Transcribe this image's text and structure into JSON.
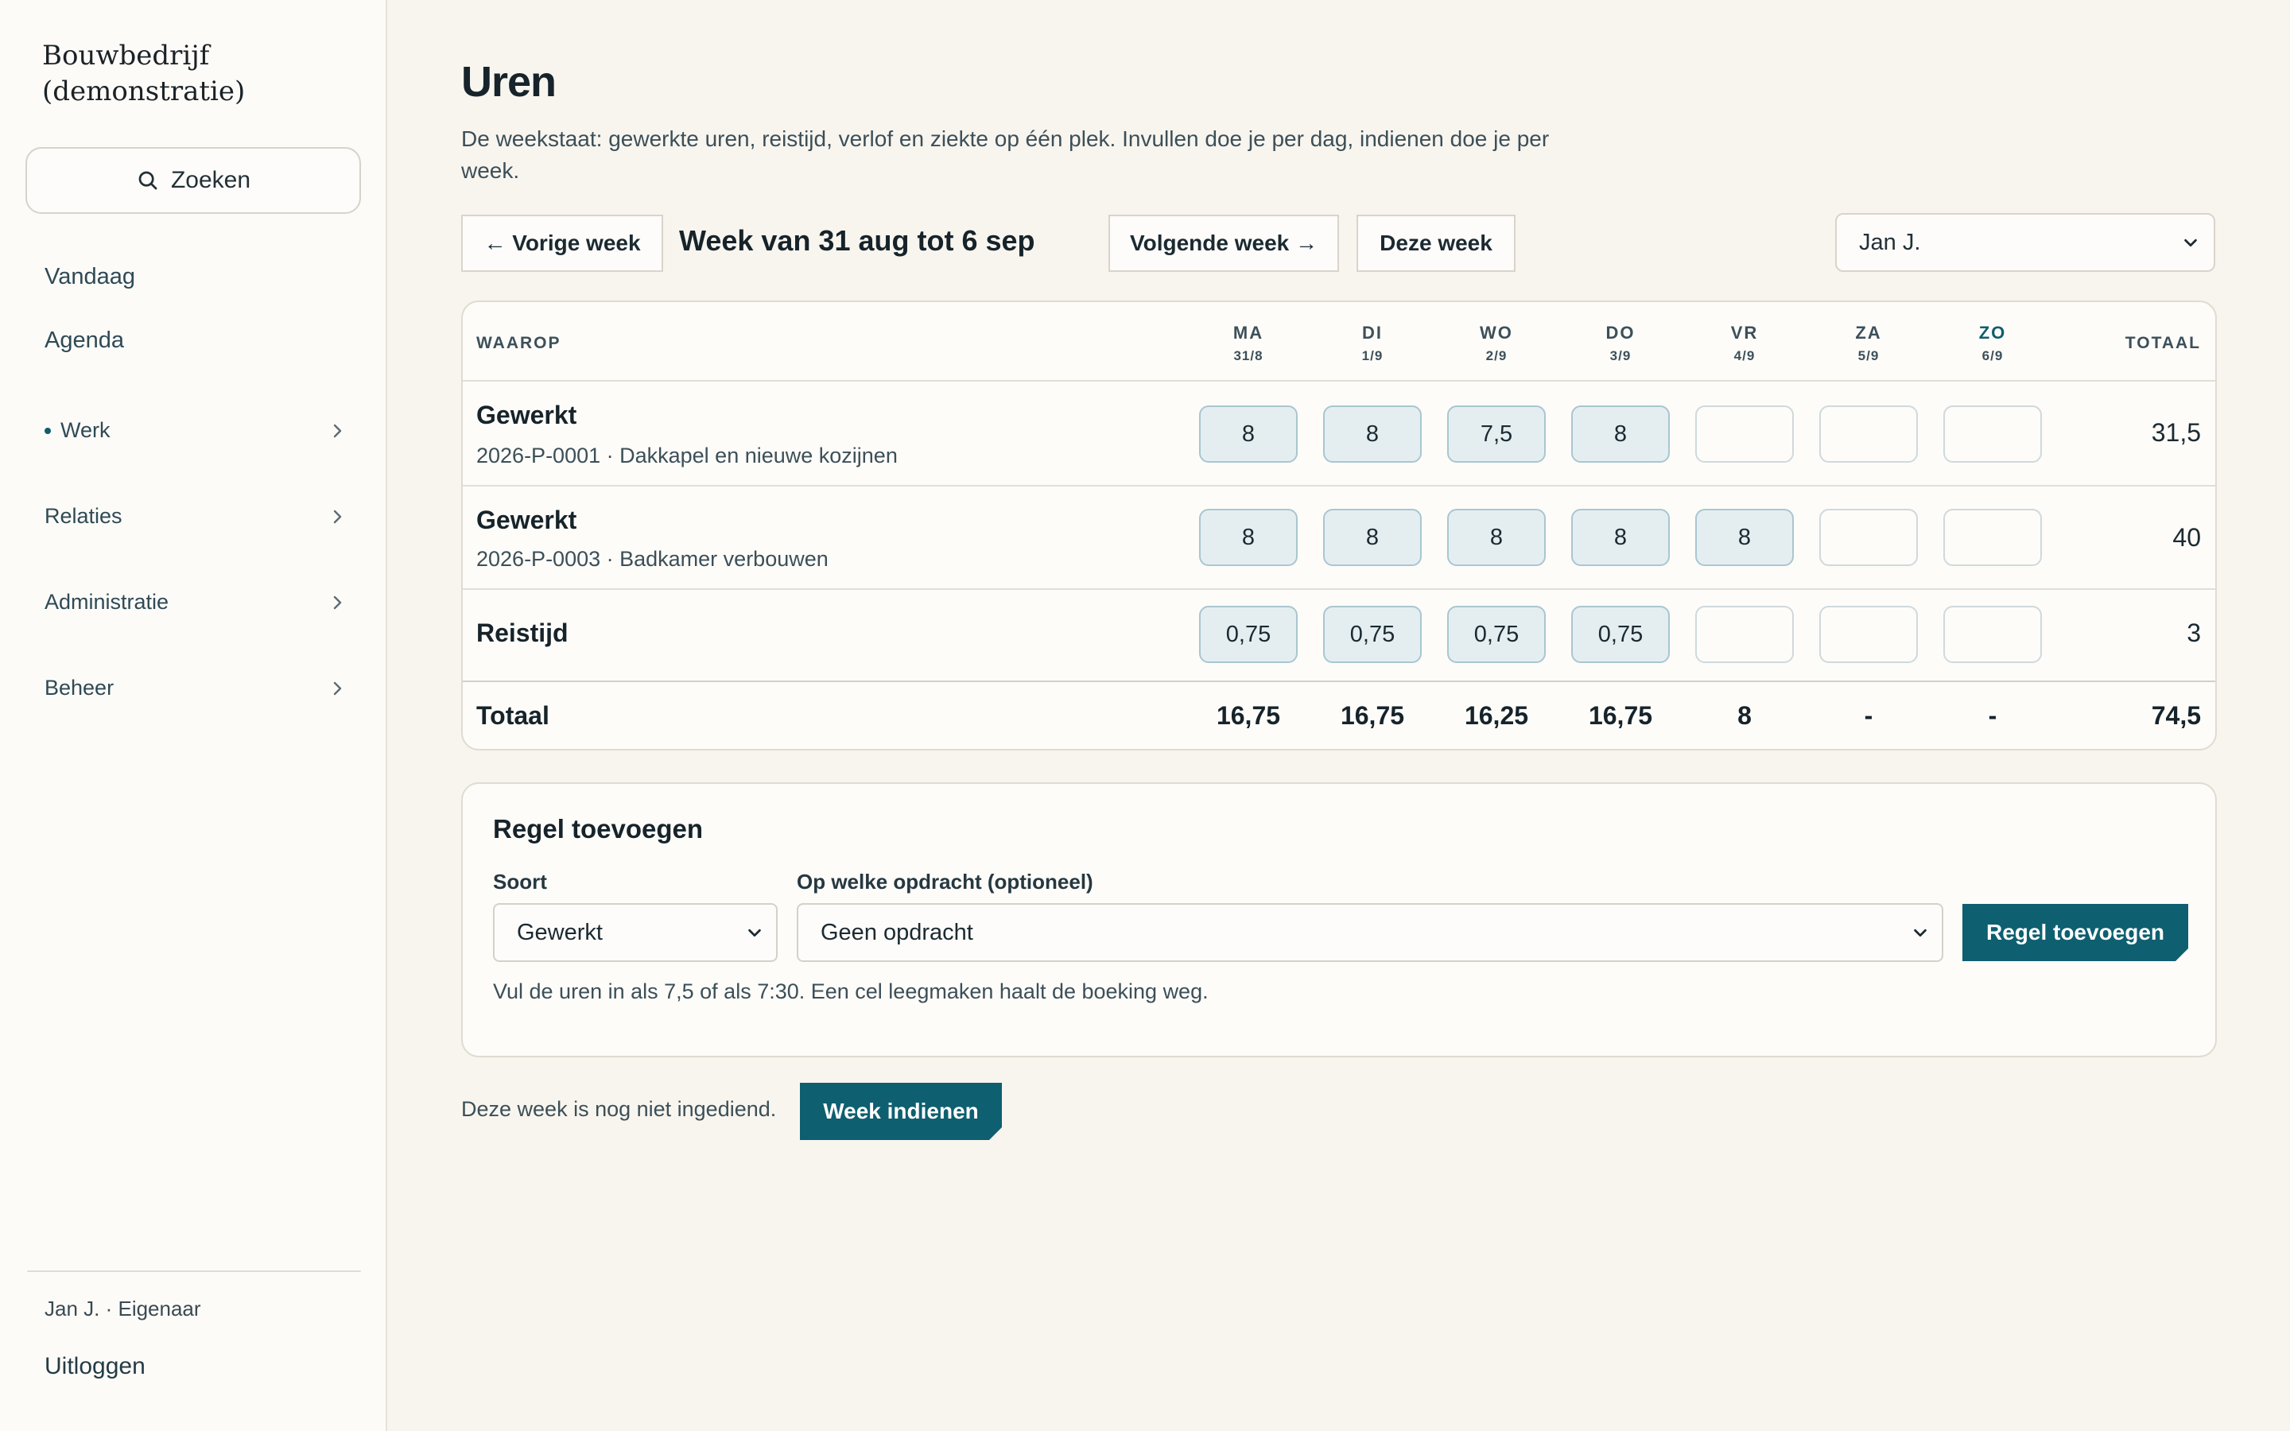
{
  "sidebar": {
    "brand": "Bouwbedrijf (demonstratie)",
    "search_label": "Zoeken",
    "items": [
      {
        "label": "Vandaag"
      },
      {
        "label": "Agenda"
      },
      {
        "label": "Werk"
      },
      {
        "label": "Relaties"
      },
      {
        "label": "Administratie"
      },
      {
        "label": "Beheer"
      }
    ],
    "user": "Jan J. · Eigenaar",
    "logout": "Uitloggen"
  },
  "header": {
    "title": "Uren",
    "description": "De weekstaat: gewerkte uren, reistijd, verlof en ziekte op één plek. Invullen doe je per dag, indienen doe je per week."
  },
  "week_nav": {
    "prev": "← Vorige week",
    "label": "Week van 31 aug tot 6 sep",
    "next": "Volgende week →",
    "current": "Deze week",
    "user_select": "Jan J."
  },
  "table": {
    "col_waarop": "WAAROP",
    "col_total": "TOTAAL",
    "days": [
      {
        "name": "MA",
        "date": "31/8"
      },
      {
        "name": "DI",
        "date": "1/9"
      },
      {
        "name": "WO",
        "date": "2/9"
      },
      {
        "name": "DO",
        "date": "3/9"
      },
      {
        "name": "VR",
        "date": "4/9"
      },
      {
        "name": "ZA",
        "date": "5/9"
      },
      {
        "name": "ZO",
        "date": "6/9"
      }
    ],
    "rows": [
      {
        "title": "Gewerkt",
        "sub": "2026-P-0001 · Dakkapel en nieuwe kozijnen",
        "values": [
          "8",
          "8",
          "7,5",
          "8",
          "",
          "",
          ""
        ],
        "total": "31,5"
      },
      {
        "title": "Gewerkt",
        "sub": "2026-P-0003 · Badkamer verbouwen",
        "values": [
          "8",
          "8",
          "8",
          "8",
          "8",
          "",
          ""
        ],
        "total": "40"
      },
      {
        "title": "Reistijd",
        "sub": "",
        "values": [
          "0,75",
          "0,75",
          "0,75",
          "0,75",
          "",
          "",
          ""
        ],
        "total": "3"
      }
    ],
    "totals": {
      "label": "Totaal",
      "values": [
        "16,75",
        "16,75",
        "16,25",
        "16,75",
        "8",
        "-",
        "-"
      ],
      "grand": "74,5"
    }
  },
  "add_rule": {
    "title": "Regel toevoegen",
    "soort_label": "Soort",
    "soort_value": "Gewerkt",
    "opdracht_label": "Op welke opdracht (optioneel)",
    "opdracht_value": "Geen opdracht",
    "button": "Regel toevoegen",
    "hint": "Vul de uren in als 7,5 of als 7:30. Een cel leegmaken haalt de boeking weg."
  },
  "submit": {
    "status": "Deze week is nog niet ingediend.",
    "button": "Week indienen"
  },
  "colors": {
    "accent": "#0e5f70",
    "background": "#f8f5ef",
    "filled_cell": "#e4eef1"
  }
}
